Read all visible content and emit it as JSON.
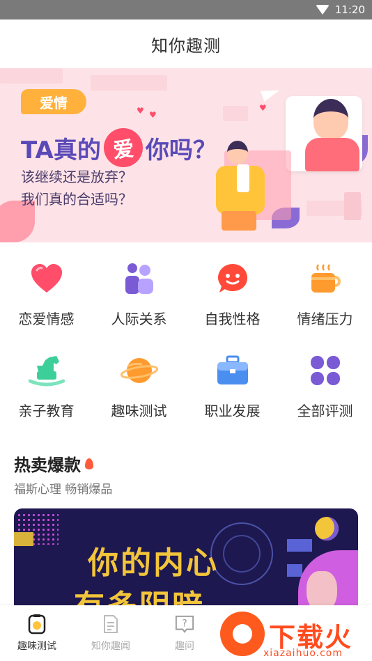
{
  "status_bar": {
    "time": "11:20"
  },
  "header": {
    "title": "知你趣测"
  },
  "banner": {
    "tag": "爱情",
    "headline_before": "TA真的",
    "headline_love": "爱",
    "headline_after": "你吗？",
    "line1": "该继续还是放弃？",
    "line2": "我们真的合适吗？"
  },
  "categories": [
    {
      "label": "恋爱情感",
      "icon": "heart-icon",
      "color": "#ff4d6a"
    },
    {
      "label": "人际关系",
      "icon": "people-icon",
      "color": "#7b5ad6"
    },
    {
      "label": "自我性格",
      "icon": "chat-face-icon",
      "color": "#ff4a3a"
    },
    {
      "label": "情绪压力",
      "icon": "coffee-cup-icon",
      "color": "#ff9a2e"
    },
    {
      "label": "亲子教育",
      "icon": "rocking-horse-icon",
      "color": "#3ccf9a"
    },
    {
      "label": "趣味测试",
      "icon": "planet-icon",
      "color": "#ff9a2e"
    },
    {
      "label": "职业发展",
      "icon": "briefcase-icon",
      "color": "#4a8ef0"
    },
    {
      "label": "全部评测",
      "icon": "grid-clover-icon",
      "color": "#7b5ad6"
    }
  ],
  "hot": {
    "title": "热卖爆款",
    "subtitle": "福斯心理 畅销爆品"
  },
  "promo": {
    "text_line1": "你的内心",
    "text_line2": "有多阴暗"
  },
  "bottom_nav": [
    {
      "label": "趣味测试",
      "icon": "test-jar-icon",
      "active": true
    },
    {
      "label": "知你趣闻",
      "icon": "document-icon",
      "active": false
    },
    {
      "label": "趣问",
      "icon": "question-icon",
      "active": false
    }
  ],
  "watermark": {
    "text": "下载火",
    "url": "xiazaihuo.com"
  }
}
